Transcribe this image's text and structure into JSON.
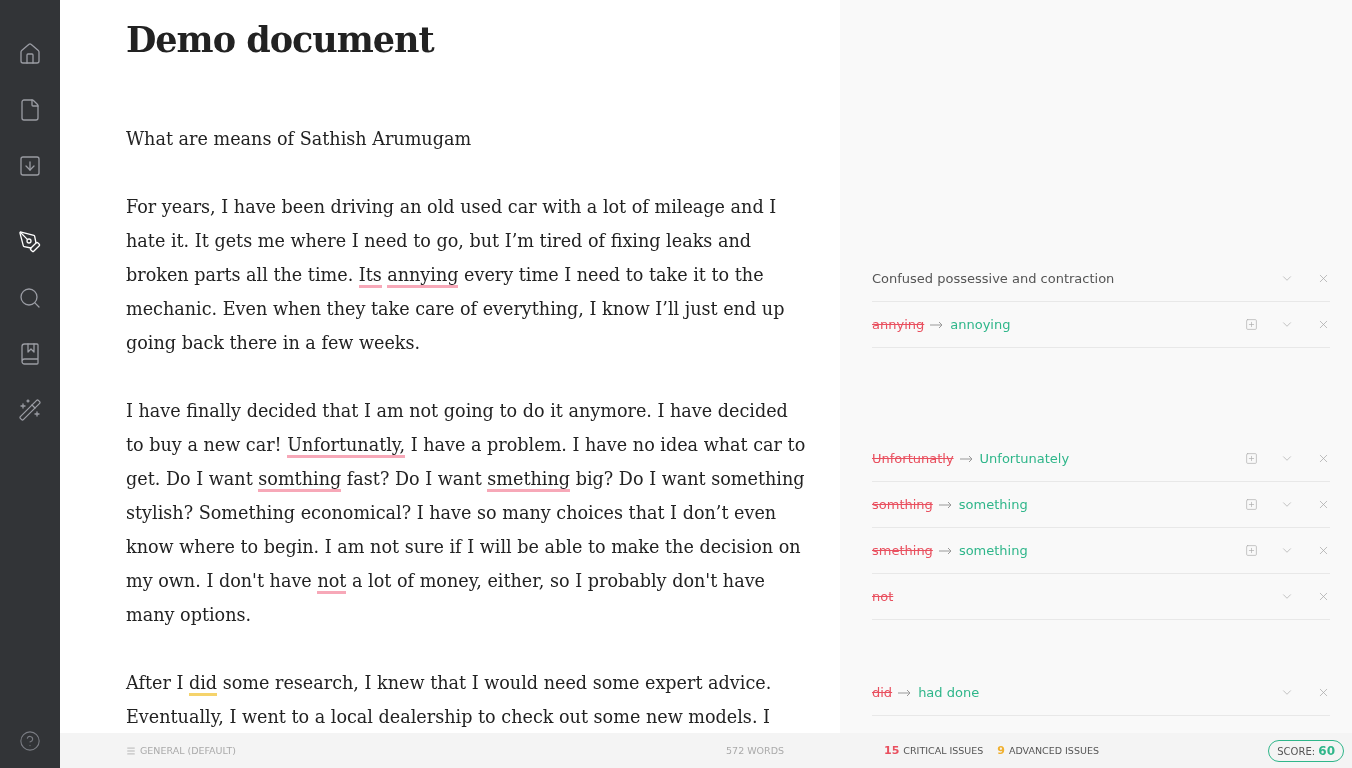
{
  "sidebar": {
    "items": [
      {
        "selected": false
      },
      {
        "selected": false
      },
      {
        "selected": false
      },
      {
        "selected": true
      },
      {
        "selected": false
      },
      {
        "selected": false
      },
      {
        "selected": false
      }
    ]
  },
  "document": {
    "title": "Demo document",
    "paragraphs": [
      [
        {
          "text": "What are means of Sathish Arumugam"
        }
      ],
      [
        {
          "text": "For years, I have been driving an old used car with a lot of mileage and I hate it. It gets me where I need to go, but I’m tired of fixing leaks and broken parts all the time. "
        },
        {
          "text": "Its",
          "color": "#f7a8b8"
        },
        {
          "text": "annying",
          "color": "#f7a8b8"
        },
        {
          "text": " every time I need to take it to the mechanic. Even when they take care of everything, I know I’ll just end up going back there in a few weeks."
        }
      ],
      [
        {
          "text": "I have finally decided that I am not going to do it anymore. I have decided to buy a new car! "
        },
        {
          "text": "Unfortunatly,",
          "color": "#f7a8b8"
        },
        {
          "text": " I have a problem. I have no idea what car to get. Do I want "
        },
        {
          "text": "somthing",
          "color": "#f7a8b8"
        },
        {
          "text": " fast? Do I want "
        },
        {
          "text": "smething",
          "color": "#f7a8b8"
        },
        {
          "text": " big? Do I want something stylish? Something economical? I have so many choices that I don’t even know where to begin. I am not sure if I will be able to make the decision on my own. I don't have "
        },
        {
          "text": "not",
          "color": "#f7a8b8"
        },
        {
          "text": " a lot of money, either, so I probably don't have many options."
        }
      ],
      [
        {
          "text": "After I "
        },
        {
          "text": "did",
          "color": "#f5d36b"
        },
        {
          "text": " some research, I knew that I would need some expert advice. Eventually, I went to a local dealership to check out some new models. I"
        }
      ]
    ]
  },
  "issues": {
    "groups": [
      [
        {
          "kind": "message",
          "text": "Confused possessive and contraction",
          "addable": false
        },
        {
          "kind": "replace",
          "from": "annying",
          "to": "annoying",
          "addable": true
        }
      ],
      [
        {
          "kind": "replace",
          "from": "Unfortunatly",
          "to": "Unfortunately",
          "addable": true
        },
        {
          "kind": "replace",
          "from": "somthing",
          "to": "something",
          "addable": true
        },
        {
          "kind": "replace",
          "from": "smething",
          "to": "something",
          "addable": true
        },
        {
          "kind": "remove",
          "from": "not",
          "addable": false
        }
      ],
      [
        {
          "kind": "replace",
          "from": "did",
          "to": "had done",
          "addable": false
        }
      ]
    ]
  },
  "status_bar": {
    "style": "GENERAL (DEFAULT)",
    "words": "572 WORDS",
    "critical_count": "15",
    "critical_label": "CRITICAL ISSUES",
    "advanced_count": "9",
    "advanced_label": "ADVANCED ISSUES",
    "score_label": "SCORE:",
    "score": "60"
  }
}
